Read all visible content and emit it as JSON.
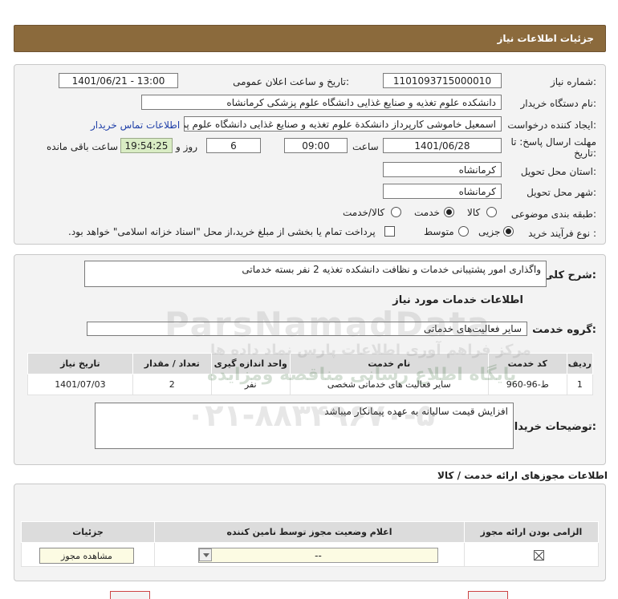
{
  "header": {
    "title": "جزئیات اطلاعات نیاز"
  },
  "form": {
    "need_number_label": "شماره نیاز:",
    "need_number": "1101093715000010",
    "announce_label": "تاریخ و ساعت اعلان عمومی:",
    "announce_value": "1401/06/21 - 13:00",
    "buyer_org_label": "نام دستگاه خریدار:",
    "buyer_org": "دانشکده علوم تغذیه و صنایع غذایی دانشگاه علوم پزشکی کرمانشاه",
    "requester_label": "ایجاد کننده درخواست:",
    "requester": "اسمعیل خاموشی کارپرداز دانشکدة علوم تغذیه و صنایع غذایی دانشگاه علوم پز",
    "contact_link": "اطلاعات تماس خریدار",
    "deadline_label_1": "مهلت ارسال پاسخ: تا",
    "deadline_label_2": "تاریخ:",
    "deadline_date": "1401/06/28",
    "time_label": "ساعت",
    "deadline_time": "09:00",
    "days_value": "6",
    "days_label": "روز و",
    "remaining_time": "19:54:25",
    "remaining_label": "ساعت باقی مانده",
    "province_label": "استان محل تحویل:",
    "province": "کرمانشاه",
    "city_label": "شهر محل تحویل:",
    "city": "کرمانشاه",
    "category_label": "طبقه بندی موضوعی:",
    "category_options": [
      "کالا",
      "خدمت",
      "کالا/خدمت"
    ],
    "purchase_type_label": "نوع فرآیند خرید :",
    "purchase_options": [
      "جزیی",
      "متوسط"
    ],
    "payment_note": "پرداخت تمام یا بخشی از مبلغ خرید،از محل \"اسناد خزانه اسلامی\" خواهد بود."
  },
  "summary": {
    "label": "شرح کلی نیاز:",
    "value": "واگذاری امور پشتیبانی  خدمات و نظافت دانشکده تغذیه 2 نفر بسته خدماتی",
    "services_title": "اطلاعات خدمات مورد نیاز",
    "service_group_label": "گروه خدمت:",
    "service_group": "سایر فعالیت‌های خدماتی"
  },
  "table": {
    "headers": [
      "ردیف",
      "کد خدمت",
      "نام خدمت",
      "واحد اندازه گیری",
      "تعداد / مقدار",
      "تاریخ نیاز"
    ],
    "rows": [
      [
        "1",
        "ط-96-960",
        "سایر فعالیت های خدماتی شخصی",
        "نفر",
        "2",
        "1401/07/03"
      ]
    ]
  },
  "buyer_notes": {
    "label": "توضیحات خریدار:",
    "value": "افزایش قیمت سالیانه  به عهده پیمانکار میباشد"
  },
  "permits": {
    "title": "اطلاعات مجوزهای ارائه خدمت / کالا",
    "headers": [
      "الزامی بودن ارائه مجوز",
      "اعلام وضعیت مجوز توسط نامین کننده",
      "جزئیات"
    ],
    "select_value": "--",
    "view_button": "مشاهده مجوز"
  },
  "watermark": {
    "logo_text": "ParsNamadData",
    "caption": "مرکز فراهم آوری اطلاعات پارس نماد داده ها",
    "site": "پایگاه اطلاع رسانی مناقصه ومزایده",
    "phone": "۰۲۱-۸۸۳۴۹۶۷۰-۵"
  },
  "colors": {
    "header_bg": "#8b6a3c",
    "remaining_bg": "#d9ecc4",
    "link": "#1f3fa8"
  }
}
